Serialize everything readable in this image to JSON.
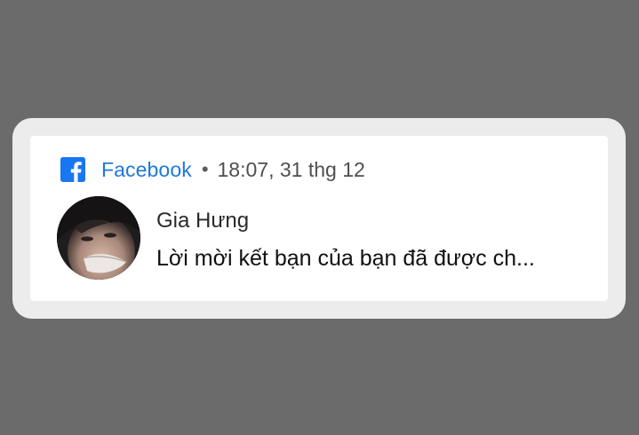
{
  "notification": {
    "app_name": "Facebook",
    "separator": "•",
    "timestamp": "18:07, 31 thg 12",
    "app_icon": "facebook-logo-icon",
    "sender_name": "Gia Hưng",
    "message": "Lời mời kết bạn của bạn đã được ch...",
    "accent_color": "#1877f2"
  }
}
